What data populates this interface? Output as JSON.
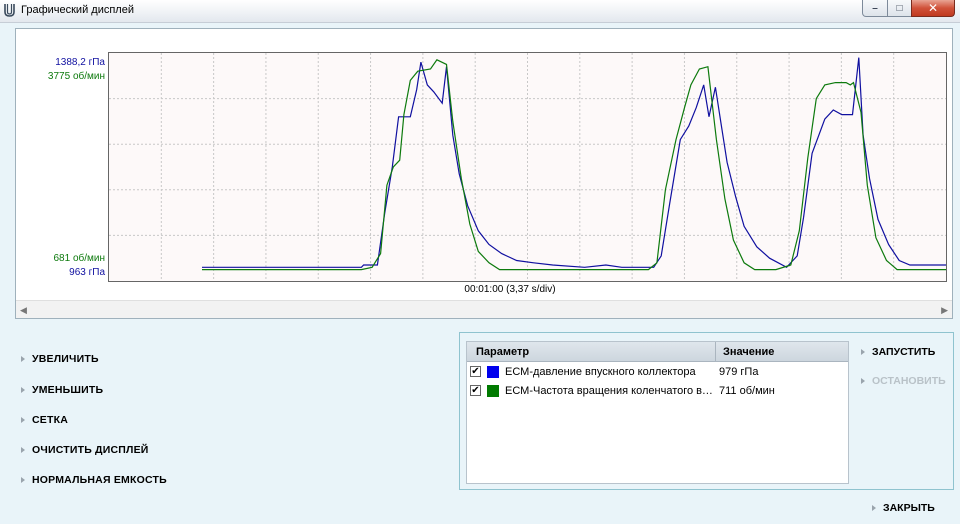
{
  "window": {
    "title": "Графический дисплей",
    "controls": {
      "minimize": "–",
      "maximize": "□",
      "close": "✕"
    }
  },
  "chart": {
    "timebase": "00:01:00 (3,37 s/div)"
  },
  "chart_data": {
    "type": "line",
    "grid": true,
    "x": [
      0,
      60
    ],
    "xunit": "s",
    "series": [
      {
        "name": "ЕСМ-давление впускного коллектора",
        "color": "#1010a0",
        "ylim_labels": [
          "963 гПа",
          "1388,2 гПа"
        ],
        "ylim": [
          963,
          1388.2
        ],
        "shape": [
          [
            0.0,
            0.06
          ],
          [
            15.0,
            0.06
          ],
          [
            15.2,
            0.07
          ],
          [
            16.5,
            0.07
          ],
          [
            17.2,
            0.3
          ],
          [
            17.9,
            0.5
          ],
          [
            18.5,
            0.72
          ],
          [
            19.6,
            0.72
          ],
          [
            20.2,
            0.84
          ],
          [
            20.6,
            0.96
          ],
          [
            21.2,
            0.86
          ],
          [
            21.8,
            0.83
          ],
          [
            22.6,
            0.78
          ],
          [
            23.0,
            0.94
          ],
          [
            23.6,
            0.64
          ],
          [
            24.2,
            0.47
          ],
          [
            25.0,
            0.33
          ],
          [
            26.0,
            0.22
          ],
          [
            27.0,
            0.16
          ],
          [
            28.2,
            0.12
          ],
          [
            29.6,
            0.09
          ],
          [
            31.2,
            0.08
          ],
          [
            33.0,
            0.07
          ],
          [
            36.0,
            0.06
          ],
          [
            38.0,
            0.07
          ],
          [
            39.5,
            0.06
          ],
          [
            42.5,
            0.06
          ],
          [
            43.2,
            0.11
          ],
          [
            44.0,
            0.34
          ],
          [
            45.0,
            0.62
          ],
          [
            45.8,
            0.68
          ],
          [
            46.5,
            0.76
          ],
          [
            47.2,
            0.86
          ],
          [
            47.7,
            0.72
          ],
          [
            48.3,
            0.85
          ],
          [
            48.8,
            0.7
          ],
          [
            49.4,
            0.52
          ],
          [
            50.2,
            0.37
          ],
          [
            51.0,
            0.24
          ],
          [
            52.2,
            0.15
          ],
          [
            53.4,
            0.1
          ],
          [
            55.0,
            0.06
          ],
          [
            56.0,
            0.11
          ],
          [
            56.6,
            0.28
          ],
          [
            57.4,
            0.56
          ],
          [
            58.6,
            0.71
          ],
          [
            59.4,
            0.75
          ],
          [
            60.2,
            0.73
          ],
          [
            60.8,
            0.73
          ],
          [
            61.2,
            0.73
          ],
          [
            61.8,
            0.98
          ],
          [
            62.2,
            0.64
          ],
          [
            62.8,
            0.45
          ],
          [
            63.6,
            0.27
          ],
          [
            64.6,
            0.16
          ],
          [
            65.6,
            0.09
          ],
          [
            66.6,
            0.07
          ],
          [
            70.0,
            0.07
          ]
        ]
      },
      {
        "name": "ЕСМ-Частота вращения коленчатого вала",
        "color": "#0d7a0d",
        "ylim_labels": [
          "681 об/мин",
          "3775 об/мин"
        ],
        "ylim": [
          681,
          3775
        ],
        "shape": [
          [
            0.0,
            0.05
          ],
          [
            15.0,
            0.05
          ],
          [
            16.0,
            0.06
          ],
          [
            16.8,
            0.12
          ],
          [
            17.4,
            0.42
          ],
          [
            18.0,
            0.5
          ],
          [
            18.6,
            0.53
          ],
          [
            19.0,
            0.73
          ],
          [
            19.6,
            0.88
          ],
          [
            20.3,
            0.92
          ],
          [
            21.5,
            0.93
          ],
          [
            22.1,
            0.97
          ],
          [
            23.0,
            0.95
          ],
          [
            23.6,
            0.7
          ],
          [
            24.4,
            0.45
          ],
          [
            25.2,
            0.25
          ],
          [
            26.0,
            0.13
          ],
          [
            27.0,
            0.08
          ],
          [
            28.0,
            0.05
          ],
          [
            31.0,
            0.05
          ],
          [
            34.0,
            0.05
          ],
          [
            38.0,
            0.05
          ],
          [
            42.0,
            0.05
          ],
          [
            42.8,
            0.08
          ],
          [
            43.6,
            0.4
          ],
          [
            44.6,
            0.62
          ],
          [
            45.4,
            0.76
          ],
          [
            46.0,
            0.86
          ],
          [
            46.8,
            0.93
          ],
          [
            47.6,
            0.94
          ],
          [
            48.4,
            0.62
          ],
          [
            49.2,
            0.36
          ],
          [
            50.0,
            0.18
          ],
          [
            51.0,
            0.08
          ],
          [
            52.0,
            0.05
          ],
          [
            54.0,
            0.05
          ],
          [
            55.4,
            0.07
          ],
          [
            56.2,
            0.22
          ],
          [
            57.0,
            0.54
          ],
          [
            57.8,
            0.8
          ],
          [
            58.6,
            0.86
          ],
          [
            59.6,
            0.87
          ],
          [
            60.6,
            0.87
          ],
          [
            61.0,
            0.86
          ],
          [
            61.3,
            0.87
          ],
          [
            62.0,
            0.74
          ],
          [
            62.6,
            0.42
          ],
          [
            63.4,
            0.19
          ],
          [
            64.4,
            0.09
          ],
          [
            65.4,
            0.05
          ],
          [
            67.0,
            0.05
          ],
          [
            70.0,
            0.05
          ]
        ]
      }
    ]
  },
  "commands": [
    {
      "label": "УВЕЛИЧИТЬ"
    },
    {
      "label": "УМЕНЬШИТЬ"
    },
    {
      "label": "СЕТКА"
    },
    {
      "label": "ОЧИСТИТЬ ДИСПЛЕЙ"
    },
    {
      "label": "НОРМАЛЬНАЯ ЕМКОСТЬ"
    }
  ],
  "params": {
    "col_param": "Параметр",
    "col_value": "Значение",
    "rows": [
      {
        "checked": "✔",
        "color": "#0000ee",
        "name": "ЕСМ-давление впускного коллектора",
        "value": "979 гПа"
      },
      {
        "checked": "✔",
        "color": "#007a00",
        "name": "ЕСМ-Частота вращения коленчатого вала",
        "value": "711 об/мин"
      }
    ]
  },
  "actions": {
    "start": "ЗАПУСТИТЬ",
    "stop": "ОСТАНОВИТЬ",
    "close": "ЗАКРЫТЬ"
  }
}
